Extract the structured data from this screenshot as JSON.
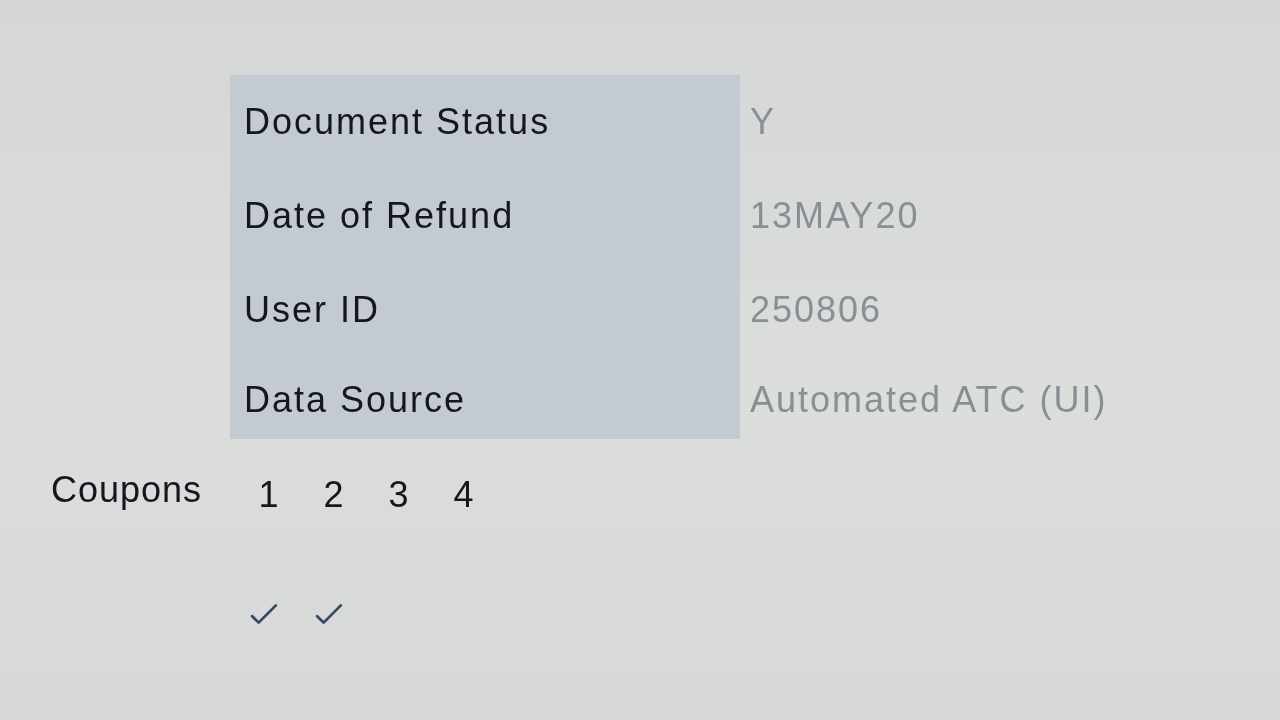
{
  "fields": [
    {
      "label": "Document Status",
      "value": "Y"
    },
    {
      "label": "Date of Refund",
      "value": "13MAY20"
    },
    {
      "label": "User ID",
      "value": "250806"
    },
    {
      "label": "Data Source",
      "value": "Automated ATC (UI)"
    }
  ],
  "coupons": {
    "label": "Coupons",
    "items": [
      {
        "number": "1",
        "checked": true
      },
      {
        "number": "2",
        "checked": true
      },
      {
        "number": "3",
        "checked": false
      },
      {
        "number": "4",
        "checked": false
      }
    ]
  }
}
